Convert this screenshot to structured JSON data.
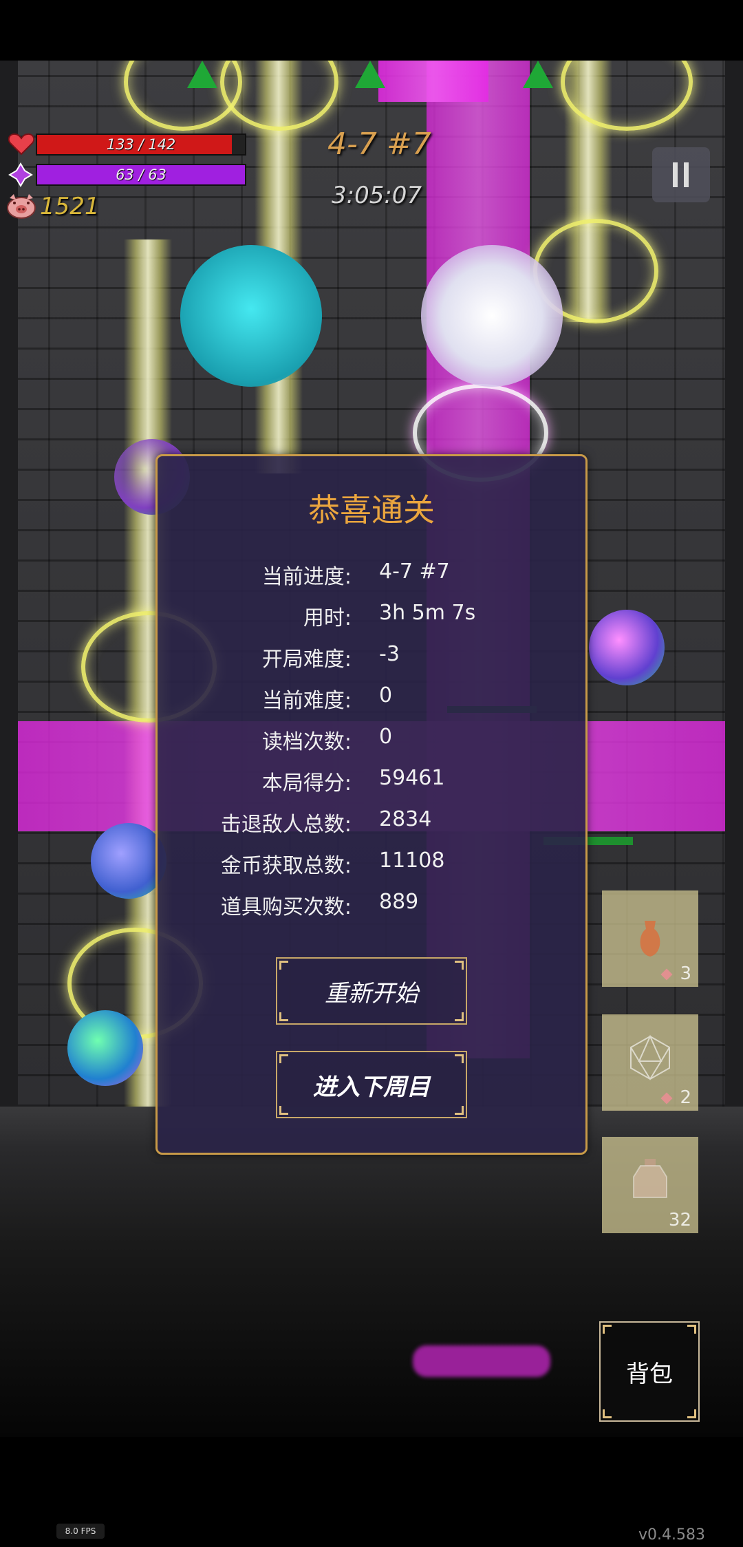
{
  "hud": {
    "hp": {
      "current": 133,
      "max": 142,
      "label": "133 / 142",
      "color": "#d01818"
    },
    "mp": {
      "current": 63,
      "max": 63,
      "label": "63 / 63",
      "color": "#a020e0"
    },
    "gold": "1521",
    "stage": "4-7 #7",
    "timer": "3:05:07"
  },
  "modal": {
    "title": "恭喜通关",
    "stats": [
      {
        "label": "当前进度:",
        "value": "4-7 #7"
      },
      {
        "label": "用时:",
        "value": "3h 5m 7s"
      },
      {
        "label": "开局难度:",
        "value": "-3"
      },
      {
        "label": "当前难度:",
        "value": "0"
      },
      {
        "label": "读档次数:",
        "value": "0"
      },
      {
        "label": "本局得分:",
        "value": "59461"
      },
      {
        "label": "击退敌人总数:",
        "value": "2834"
      },
      {
        "label": "金币获取总数:",
        "value": "11108"
      },
      {
        "label": "道具购买次数:",
        "value": "889"
      }
    ],
    "restart_label": "重新开始",
    "next_cycle_label": "进入下周目"
  },
  "items": [
    {
      "icon": "potion-icon",
      "count": "3"
    },
    {
      "icon": "d20-dice-icon",
      "count": "2"
    },
    {
      "icon": "jar-icon",
      "count": "32"
    }
  ],
  "bag_label": "背包",
  "fps": "8.0 FPS",
  "version": "v0.4.583",
  "colors": {
    "accent": "#eaa53e",
    "modal_border": "#c89a48",
    "gold": "#d9b73a"
  }
}
